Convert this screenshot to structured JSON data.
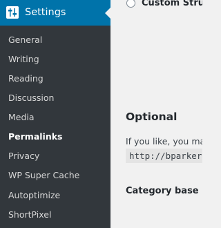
{
  "sidebar": {
    "header": {
      "title": "Settings",
      "icon": "settings-sliders-icon",
      "background": "#0073aa"
    },
    "items": [
      {
        "label": "General",
        "current": false
      },
      {
        "label": "Writing",
        "current": false
      },
      {
        "label": "Reading",
        "current": false
      },
      {
        "label": "Discussion",
        "current": false
      },
      {
        "label": "Media",
        "current": false
      },
      {
        "label": "Permalinks",
        "current": true
      },
      {
        "label": "Privacy",
        "current": false
      },
      {
        "label": "WP Super Cache",
        "current": false
      },
      {
        "label": "Autoptimize",
        "current": false
      },
      {
        "label": "ShortPixel",
        "current": false
      }
    ]
  },
  "main": {
    "custom_structure": {
      "label": "Custom Structure",
      "selected": false
    },
    "optional": {
      "heading": "Optional",
      "description": "If you like, you may",
      "url_example": "http://bparker"
    },
    "category_base": {
      "label": "Category base"
    }
  },
  "colors": {
    "sidebar_bg": "#32373c",
    "accent": "#0073aa",
    "page_bg": "#f1f1f1"
  }
}
